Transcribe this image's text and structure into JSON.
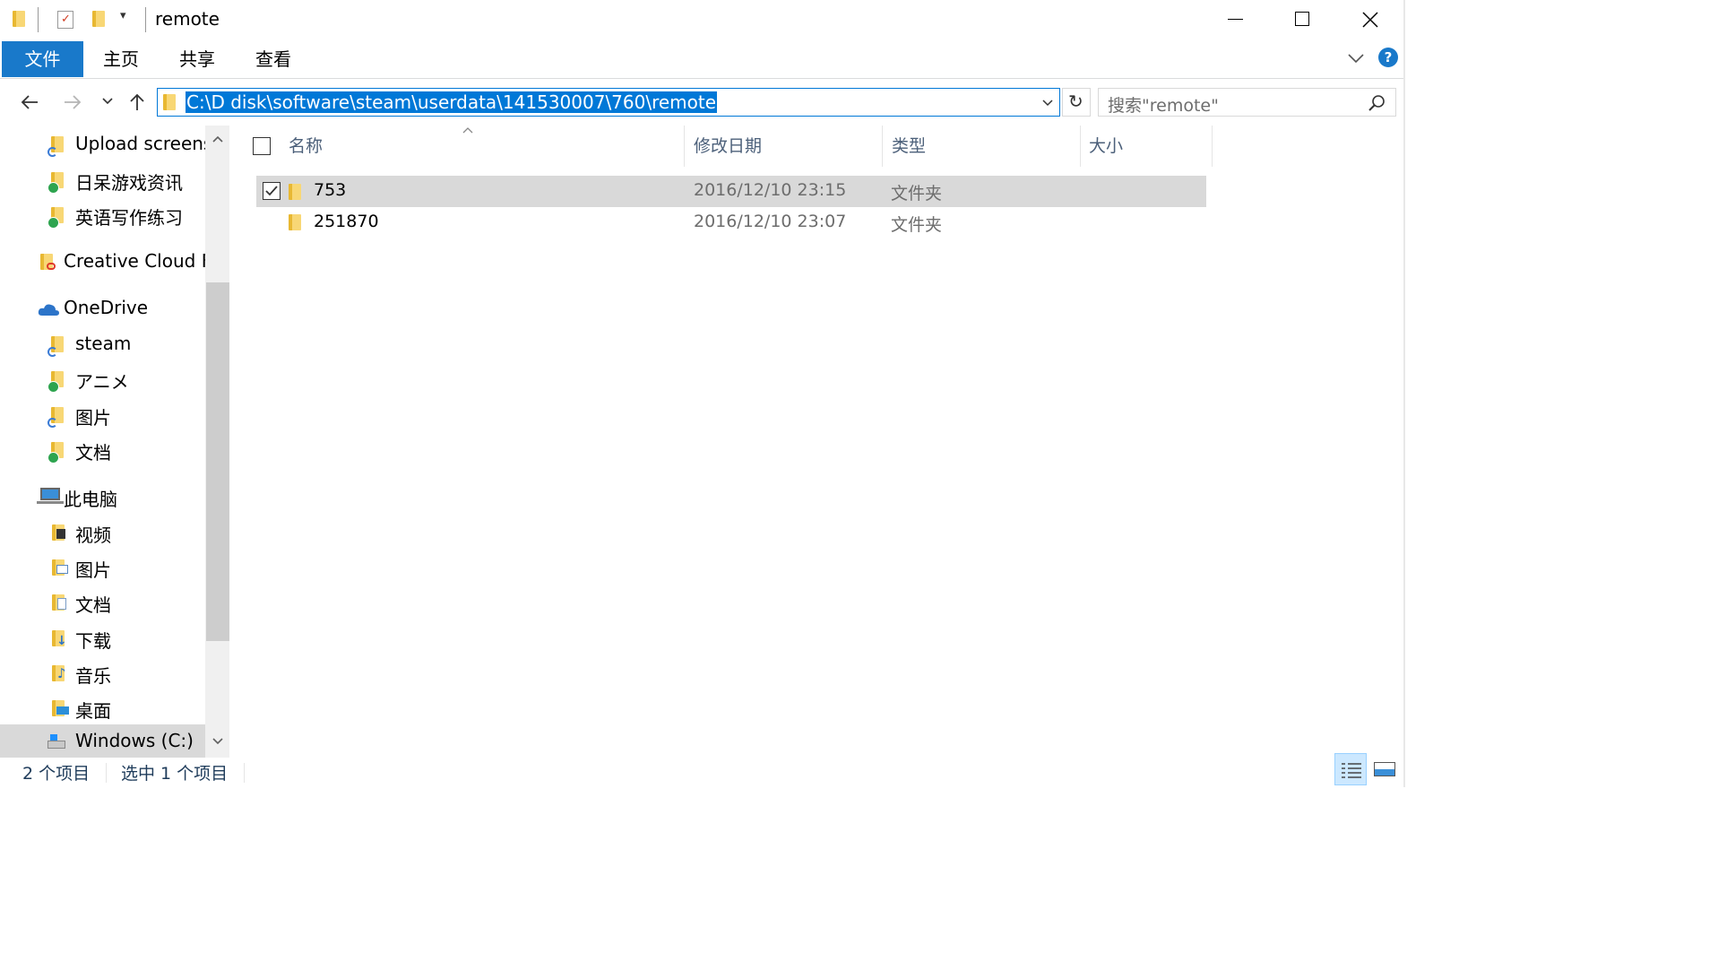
{
  "window": {
    "title": "remote"
  },
  "ribbon": {
    "tabs": [
      {
        "label": "文件",
        "active": true
      },
      {
        "label": "主页"
      },
      {
        "label": "共享"
      },
      {
        "label": "查看"
      }
    ],
    "help_label": "?"
  },
  "address_bar": {
    "path": "C:\\D disk\\software\\steam\\userdata\\141530007\\760\\remote",
    "search_placeholder": "搜索\"remote\""
  },
  "nav_pane": {
    "items": [
      {
        "label": "Upload screens",
        "icon": "folder-sync-icon"
      },
      {
        "label": "日呆游戏资讯",
        "icon": "folder-synced-icon"
      },
      {
        "label": "英语写作练习",
        "icon": "folder-synced-icon"
      },
      {
        "label": "Creative Cloud Fi",
        "icon": "creative-cloud-folder-icon"
      },
      {
        "label": "OneDrive",
        "icon": "onedrive-icon"
      },
      {
        "label": "steam",
        "icon": "folder-sync-icon"
      },
      {
        "label": "アニメ",
        "icon": "folder-synced-icon"
      },
      {
        "label": "图片",
        "icon": "folder-sync-icon"
      },
      {
        "label": "文档",
        "icon": "folder-synced-icon"
      },
      {
        "label": "此电脑",
        "icon": "computer-icon"
      },
      {
        "label": "视频",
        "icon": "videos-folder-icon"
      },
      {
        "label": "图片",
        "icon": "pictures-folder-icon"
      },
      {
        "label": "文档",
        "icon": "documents-folder-icon"
      },
      {
        "label": "下载",
        "icon": "downloads-folder-icon"
      },
      {
        "label": "音乐",
        "icon": "music-folder-icon"
      },
      {
        "label": "桌面",
        "icon": "desktop-folder-icon"
      },
      {
        "label": "Windows (C:)",
        "icon": "drive-icon",
        "selected": true
      }
    ]
  },
  "file_list": {
    "columns": [
      "名称",
      "修改日期",
      "类型",
      "大小"
    ],
    "rows": [
      {
        "name": "753",
        "modified": "2016/12/10 23:15",
        "type": "文件夹",
        "size": "",
        "selected": true,
        "checked": true
      },
      {
        "name": "251870",
        "modified": "2016/12/10 23:07",
        "type": "文件夹",
        "size": "",
        "selected": false,
        "checked": false
      }
    ]
  },
  "status_bar": {
    "item_count": "2 个项目",
    "selection": "选中 1 个项目"
  },
  "colors": {
    "accent": "#1979ca",
    "selection_row": "#d9d9d9",
    "address_highlight": "#0078d7",
    "header_text": "#4c607a"
  }
}
